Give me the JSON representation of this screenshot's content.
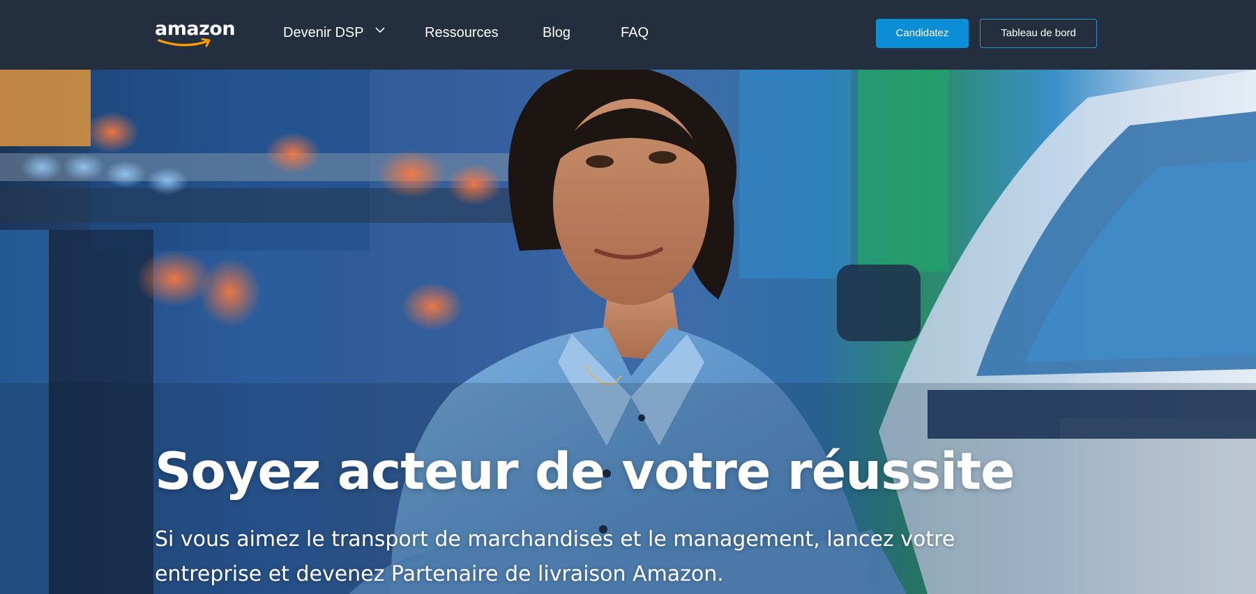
{
  "brand": {
    "logo_text": "amazon"
  },
  "nav": {
    "items": [
      {
        "label": "Devenir DSP",
        "has_dropdown": true
      },
      {
        "label": "Ressources"
      },
      {
        "label": "Blog"
      },
      {
        "label": "FAQ"
      }
    ]
  },
  "actions": {
    "apply_label": "Candidatez",
    "dashboard_label": "Tableau de bord"
  },
  "hero": {
    "title": "Soyez acteur de votre réussite",
    "subtitle": "Si vous aimez le transport de marchandises et le management, lancez votre entreprise et devenez Partenaire de livraison Amazon."
  },
  "colors": {
    "nav_background": "#232f3e",
    "primary_button": "#0c8ed6",
    "outline_border": "#2a95d4",
    "text": "#ffffff"
  },
  "icons": {
    "dropdown": "chevron-down-icon",
    "logo_smile": "amazon-smile-arrow"
  }
}
